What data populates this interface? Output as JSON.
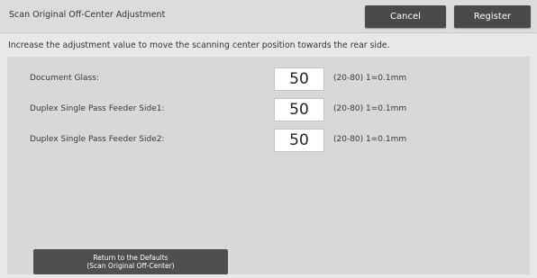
{
  "header": {
    "title": "Scan Original Off-Center Adjustment",
    "cancel_label": "Cancel",
    "register_label": "Register"
  },
  "instruction": "Increase the adjustment value to move the scanning center position towards the rear side.",
  "settings": [
    {
      "label": "Document Glass:",
      "value": "50",
      "range": "(20-80) 1=0.1mm"
    },
    {
      "label": "Duplex Single Pass Feeder Side1:",
      "value": "50",
      "range": "(20-80) 1=0.1mm"
    },
    {
      "label": "Duplex Single Pass Feeder Side2:",
      "value": "50",
      "range": "(20-80) 1=0.1mm"
    }
  ],
  "defaults_button": {
    "line1": "Return to the Defaults",
    "line2": "(Scan Original Off-Center)"
  }
}
